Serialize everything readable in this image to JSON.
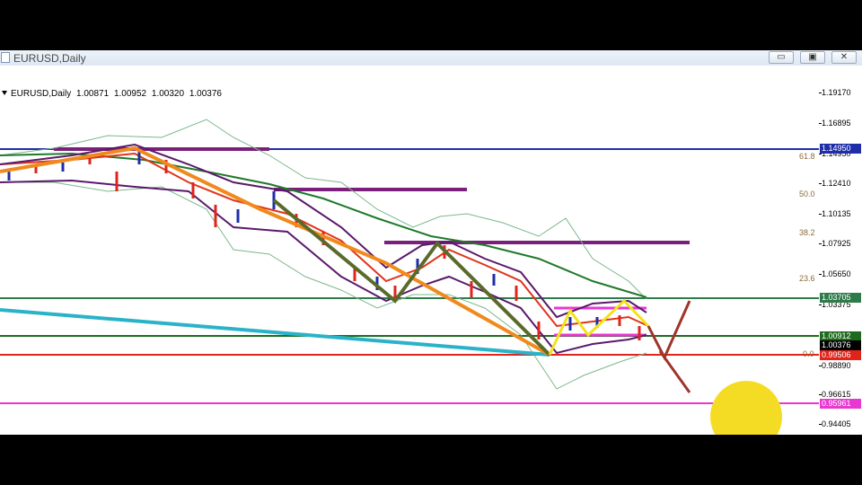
{
  "window": {
    "title": "EURUSD,Daily",
    "buttons": {
      "minimize": "▭",
      "maximize": "▣",
      "close": "✕"
    }
  },
  "info": {
    "symbol": "EURUSD,Daily",
    "open": "1.00871",
    "high": "1.00952",
    "low": "1.00320",
    "close": "1.00376"
  },
  "price_axis": {
    "ticks": [
      "1.19170",
      "1.16895",
      "1.14950",
      "1.12410",
      "1.10135",
      "1.07925",
      "1.05650",
      "1.03375",
      "1.00912",
      "1.00376",
      "0.98890",
      "0.96615",
      "0.95961",
      "0.94405"
    ],
    "labels": [
      {
        "text": "1.14950",
        "color": "#1f2ea8"
      },
      {
        "text": "1.03705",
        "color": "#2f7a4a"
      },
      {
        "text": "1.00912",
        "color": "#1e6b1e"
      },
      {
        "text": "1.00376",
        "color": "#000000"
      },
      {
        "text": "0.99506",
        "color": "#e0241b"
      },
      {
        "text": "0.95961",
        "color": "#e838d0"
      }
    ]
  },
  "fibonacci": [
    "61.8",
    "50.0",
    "38.2",
    "23.6",
    "0.0"
  ],
  "colors": {
    "blue_level": "#1f2ea8",
    "green_level": "#2f7a4a",
    "dark_green_level": "#1e6b1e",
    "red_level": "#e0241b",
    "magenta_level": "#e838d0",
    "purple_zone": "#7a1f7a",
    "orange_trend": "#f08a1c",
    "olive_trend": "#5a6a2a",
    "cyan_trend": "#2ab3c8",
    "yellow_wave": "#f2e21a",
    "brown_arrow": "#a0342a"
  }
}
